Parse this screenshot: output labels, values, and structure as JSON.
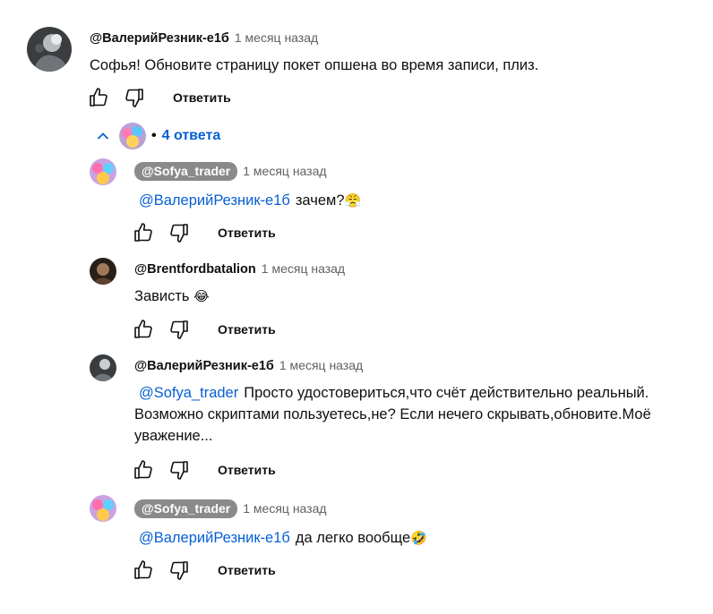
{
  "main_comment": {
    "author": "@ВалерийРезник-е1б",
    "time": "1 месяц назад",
    "text": "Софья! Обновите страницу покет опшена  во время записи, плиз.",
    "reply_label": "Ответить"
  },
  "replies_toggle": {
    "bullet": "•",
    "label": "4 ответа"
  },
  "replies": [
    {
      "author": "@Sofya_trader",
      "time": "1 месяц назад",
      "mention": "@ВалерийРезник-е1б",
      "text": "зачем?",
      "emoji": "😤",
      "reply_label": "Ответить"
    },
    {
      "author": "@Brentfordbatalion",
      "time": "1 месяц назад",
      "text": "Зависть",
      "emoji": "😂",
      "reply_label": "Ответить"
    },
    {
      "author": "@ВалерийРезник-е1б",
      "time": "1 месяц назад",
      "mention": "@Sofya_trader",
      "text_line1": "Просто удостовериться,что счёт действительно реальный.",
      "text_line2": "Возможно скриптами пользуетесь,не? Если нечего скрывать,обновите.Моё",
      "text_line3": "уважение...",
      "reply_label": "Ответить"
    },
    {
      "author": "@Sofya_trader",
      "time": "1 месяц назад",
      "mention": "@ВалерийРезник-е1б",
      "text": "да легко вообще",
      "emoji": "🤣",
      "reply_label": "Ответить"
    }
  ]
}
